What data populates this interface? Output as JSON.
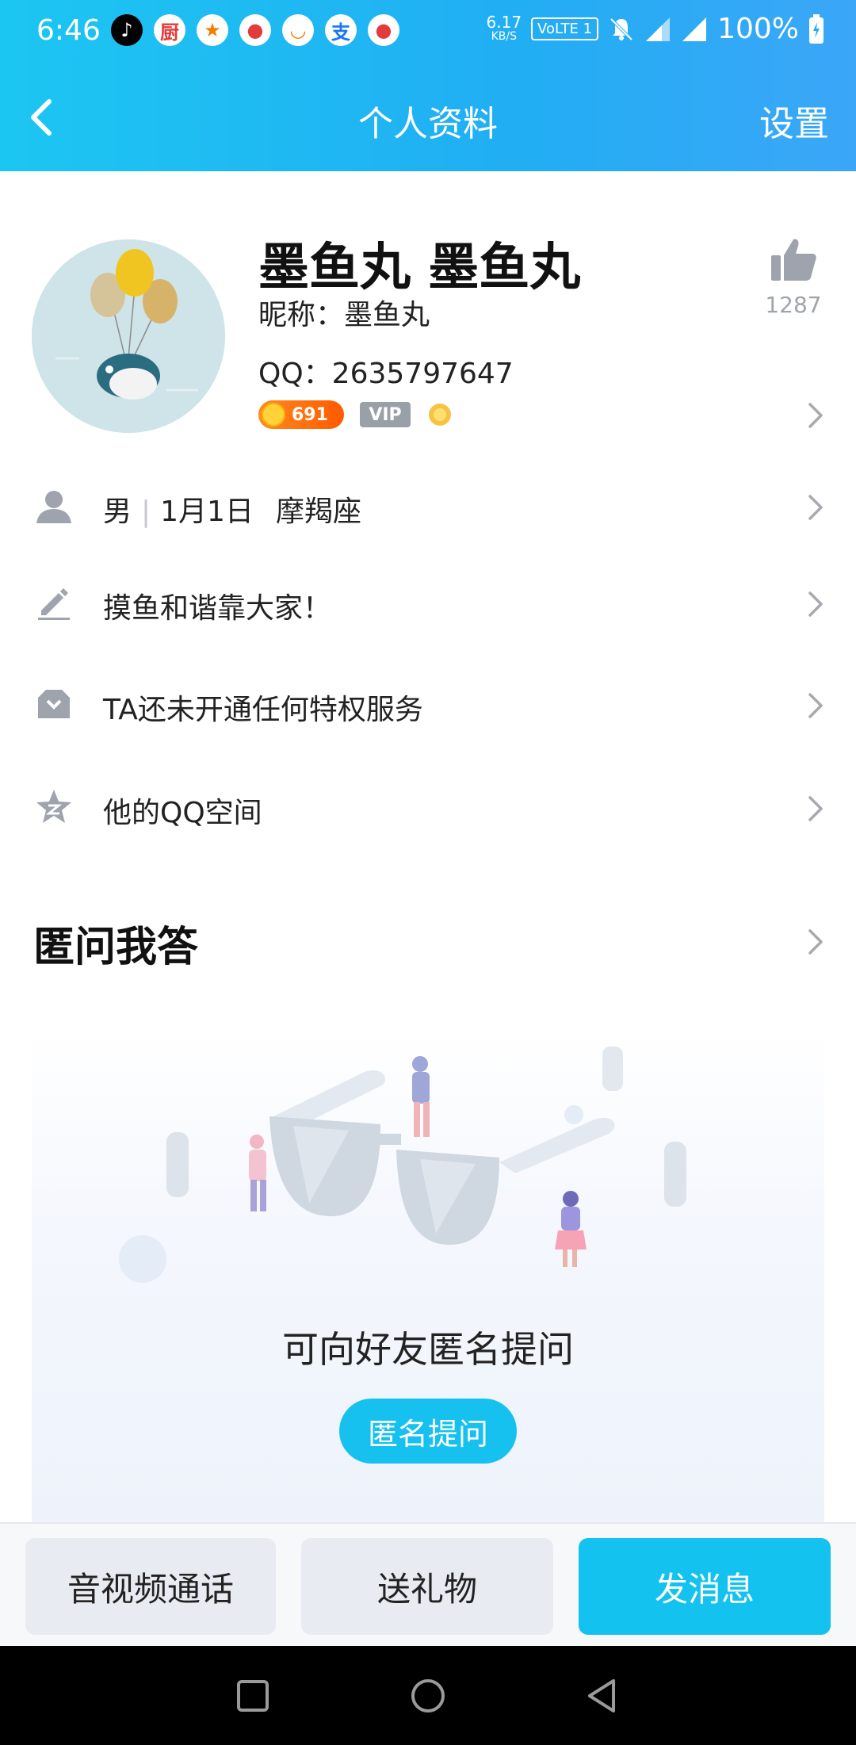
{
  "status_bar": {
    "time": "6:46",
    "speed_value": "6.17",
    "speed_unit": "KB/S",
    "volte": "VoLTE 1",
    "battery": "100%"
  },
  "nav": {
    "title": "个人资料",
    "settings": "设置"
  },
  "profile": {
    "display_name": "墨鱼丸 墨鱼丸",
    "nickname": "昵称：墨鱼丸",
    "qq": "QQ：2635797647",
    "coin_count": "691",
    "vip_label": "VIP",
    "like_count": "1287"
  },
  "info_rows": {
    "gender": "男",
    "birthday": "1月1日",
    "zodiac": "摩羯座",
    "signature": "摸鱼和谐靠大家！",
    "privilege": "TA还未开通任何特权服务",
    "qzone": "他的QQ空间"
  },
  "qa_section": {
    "title": "匿问我答",
    "prompt": "可向好友匿名提问",
    "button": "匿名提问"
  },
  "bottom_actions": {
    "call": "音视频通话",
    "gift": "送礼物",
    "message": "发消息"
  },
  "colors": {
    "accent": "#13c2ee",
    "header_start": "#1cc6f2",
    "header_end": "#3ba6f7"
  }
}
